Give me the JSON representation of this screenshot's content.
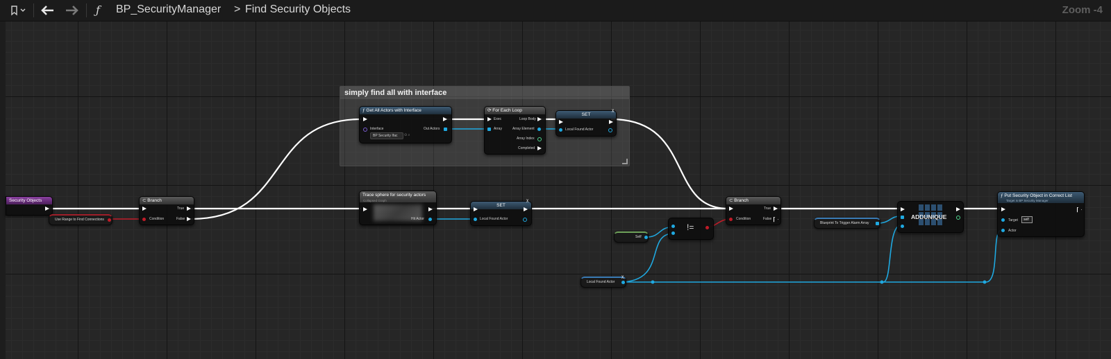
{
  "toolbar": {
    "bookmark_icon": "bookmark-icon",
    "back_icon": "arrow-left-icon",
    "forward_icon": "arrow-right-icon",
    "function_glyph": "ƒ",
    "blueprint_name": "BP_SecurityManager",
    "separator": ">",
    "graph_name": "Find Security Objects",
    "zoom": "Zoom -4"
  },
  "comment": {
    "title": "simply find all with interface"
  },
  "nodes": {
    "entry": {
      "title": "Security Objects"
    },
    "branch1": {
      "title": "Branch",
      "condition": "Condition",
      "true": "True",
      "false": "False"
    },
    "use_range": {
      "label": "Use Range to Find Connections"
    },
    "get_all": {
      "title": "Get All Actors with Interface",
      "interface": "Interface",
      "interface_value": "BP Security Ifac",
      "out": "Out Actors"
    },
    "for_each": {
      "title": "For Each Loop",
      "exec": "Exec",
      "array": "Array",
      "loop_body": "Loop Body",
      "array_element": "Array Element",
      "array_index": "Array Index",
      "completed": "Completed"
    },
    "set_top": {
      "title": "SET",
      "label": "Local Found Actor"
    },
    "trace": {
      "title": "Trace sphere for security actors",
      "sub": "Collapsed Graph",
      "hit": "Hit Actor"
    },
    "set_mid": {
      "title": "SET",
      "label": "Local Found Actor"
    },
    "branch2": {
      "title": "Branch",
      "condition": "Condition",
      "true": "True",
      "false": "False"
    },
    "self": {
      "label": "Self"
    },
    "not_equal": {
      "symbol": "!="
    },
    "local_found": {
      "label": "Local Found Actor"
    },
    "bp_trigger": {
      "label": "Blueprint To Trigger Alarm Array"
    },
    "addunique": {
      "label": "ADDUNIQUE"
    },
    "put": {
      "title": "Put Security Object in Correct List",
      "sub": "Target is BP Security Manager",
      "target": "Target",
      "target_value": "self",
      "actor": "Actor"
    }
  }
}
